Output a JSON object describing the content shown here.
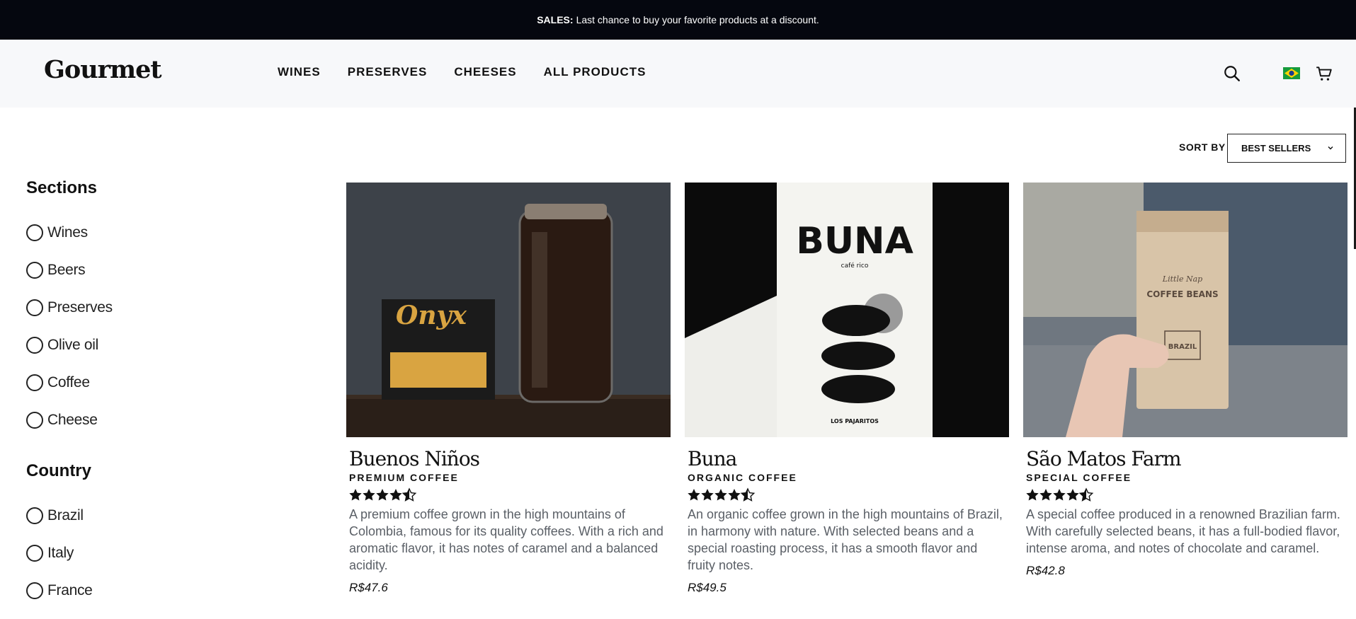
{
  "announcement": {
    "label": "SALES:",
    "text": "Last chance to buy your favorite products at a discount."
  },
  "header": {
    "logo": "Gourmet",
    "nav": [
      "WINES",
      "PRESERVES",
      "CHEESES",
      "ALL PRODUCTS"
    ],
    "icons": [
      "search-icon",
      "brazil-flag-icon",
      "cart-icon"
    ]
  },
  "sort": {
    "label": "SORT BY",
    "value": "BEST SELLERS"
  },
  "filters": {
    "sections": {
      "title": "Sections",
      "options": [
        "Wines",
        "Beers",
        "Preserves",
        "Olive oil",
        "Coffee",
        "Cheese"
      ]
    },
    "country": {
      "title": "Country",
      "options": [
        "Brazil",
        "Italy",
        "France"
      ]
    }
  },
  "products": [
    {
      "name": "Buenos Niños",
      "type": "PREMIUM COFFEE",
      "rating": 4.5,
      "description": "A premium coffee grown in the high mountains of Colombia, famous for its quality coffees. With a rich and aromatic flavor, it has notes of caramel and a balanced acidity.",
      "price": "R$47.6",
      "image_text": "Onyx"
    },
    {
      "name": "Buna",
      "type": "ORGANIC COFFEE",
      "rating": 4.5,
      "description": "An organic coffee grown in the high mountains of Brazil, in harmony with nature. With selected beans and a special roasting process, it has a smooth flavor and fruity notes.",
      "price": "R$49.5",
      "image_text": "BUNA",
      "image_sub": "café rico",
      "image_footer": "LOS PAJARITOS"
    },
    {
      "name": "São Matos Farm",
      "type": "SPECIAL COFFEE",
      "rating": 4.5,
      "description": "A special coffee produced in a renowned Brazilian farm. With carefully selected beans, it has a full-bodied flavor, intense aroma, and notes of chocolate and caramel.",
      "price": "R$42.8",
      "image_text": "COFFEE BEANS",
      "image_brand": "Little Nap",
      "image_sub": "BRAZIL"
    }
  ],
  "colors": {
    "announcement_bg": "#05070f",
    "header_bg": "#f7f8fa",
    "desc_text": "#5a5f66"
  }
}
